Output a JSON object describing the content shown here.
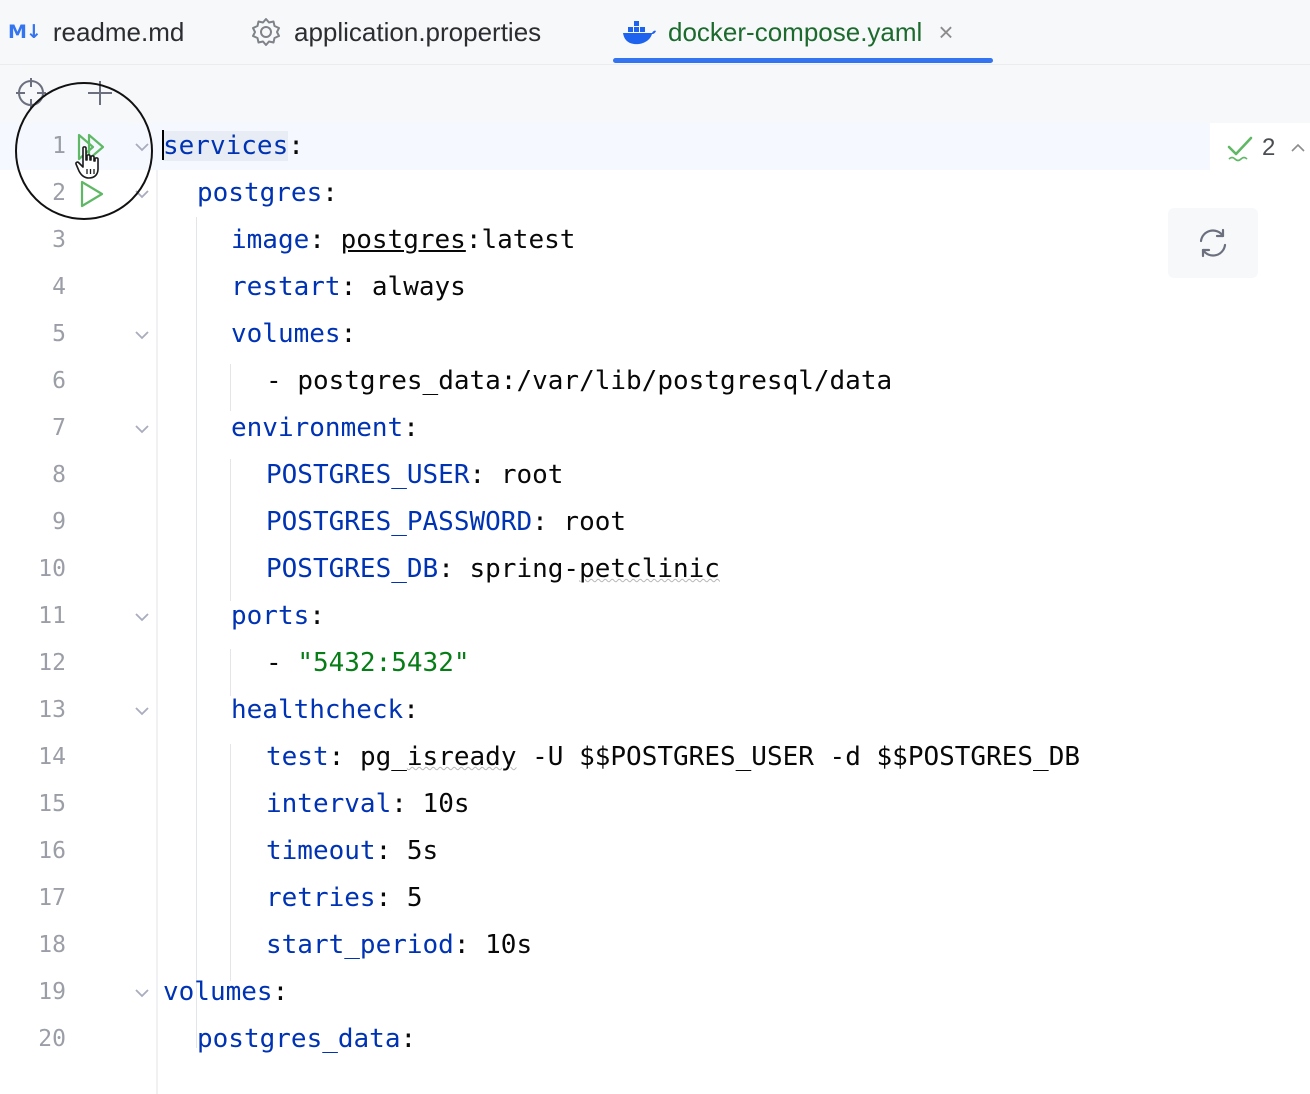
{
  "tabs": [
    {
      "badge": "M↓",
      "label": "readme.md",
      "icon": "markdown-icon"
    },
    {
      "label": "application.properties",
      "icon": "gear-icon"
    },
    {
      "label": "docker-compose.yaml",
      "icon": "docker-icon",
      "active": true,
      "close": "×"
    }
  ],
  "toolbar": {
    "icons": [
      "target-icon",
      "plus-icon"
    ]
  },
  "editor": {
    "inspection_count": "2",
    "lines": [
      {
        "n": "1"
      },
      {
        "n": "2"
      },
      {
        "n": "3"
      },
      {
        "n": "4"
      },
      {
        "n": "5"
      },
      {
        "n": "6"
      },
      {
        "n": "7"
      },
      {
        "n": "8"
      },
      {
        "n": "9"
      },
      {
        "n": "10"
      },
      {
        "n": "11"
      },
      {
        "n": "12"
      },
      {
        "n": "13"
      },
      {
        "n": "14"
      },
      {
        "n": "15"
      },
      {
        "n": "16"
      },
      {
        "n": "17"
      },
      {
        "n": "18"
      },
      {
        "n": "19"
      },
      {
        "n": "20"
      }
    ],
    "code": {
      "l1_key_a": "s",
      "l1_key_b": "ervices",
      "colon": ":",
      "l2_key": "postgres",
      "l3_key": "image",
      "l3_val_u": "postgres",
      "l3_val_rest": ":latest",
      "l4_key": "restart",
      "l4_val": "always",
      "l5_key": "volumes",
      "l6_dash": "- ",
      "l6_val": "postgres_data:/var/lib/postgresql/data",
      "l7_key": "environment",
      "l8_key": "POSTGRES_USER",
      "l8_val": "root",
      "l9_key": "POSTGRES_PASSWORD",
      "l9_val": "root",
      "l10_key": "POSTGRES_DB",
      "l10_val_a": "spring-",
      "l10_val_b": "petclinic",
      "l11_key": "ports",
      "l12_dash": "- ",
      "l12_val": "\"5432:5432\"",
      "l13_key": "healthcheck",
      "l14_key": "test",
      "l14_val_a": "pg_",
      "l14_val_b": "isready",
      "l14_val_c": " -U $$POSTGRES_USER -d $$POSTGRES_DB",
      "l15_key": "interval",
      "l15_val": "10s",
      "l16_key": "timeout",
      "l16_val": "5s",
      "l17_key": "retries",
      "l17_val": "5",
      "l18_key": "start_period",
      "l18_val": "10s",
      "l19_key": "volumes",
      "l20_key": "postgres_data"
    }
  },
  "colors": {
    "keyword": "#0033b3",
    "string": "#067d17",
    "accent": "#3574f0",
    "run": "#5fb865"
  }
}
